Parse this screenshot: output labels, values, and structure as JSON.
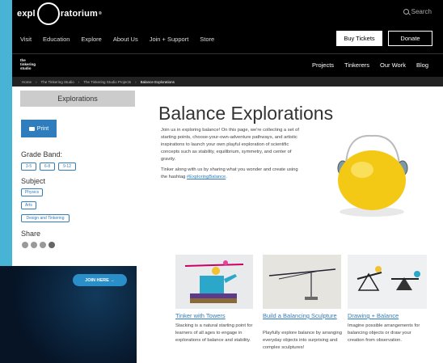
{
  "header": {
    "logo_pre": "expl",
    "logo_post": "ratorium",
    "search_label": "Search",
    "nav": [
      "Visit",
      "Education",
      "Explore",
      "About Us",
      "Join + Support",
      "Store"
    ],
    "buy_tickets": "Buy Tickets",
    "donate": "Donate"
  },
  "subheader": {
    "studio_logo": [
      "the",
      "tinkering",
      "studio"
    ],
    "nav": [
      "Projects",
      "Tinkerers",
      "Our Work",
      "Blog"
    ]
  },
  "breadcrumb": [
    "Home",
    "The Tinkering Studio",
    "The Tinkering Studio Projects",
    "Balance Explorations"
  ],
  "sidebar": {
    "tab_label": "Explorations",
    "print_label": "Print",
    "grade_band_label": "Grade Band:",
    "grade_bands": [
      "3-5",
      "6-8",
      "9-12"
    ],
    "subject_label": "Subject",
    "subjects": [
      "Physics",
      "Arts",
      "Design and Tinkering"
    ],
    "share_label": "Share"
  },
  "main": {
    "title": "Balance Explorations",
    "intro_p1": "Join us in exploring balance! On this page, we're collecting a set of starting points, choose-your-own-adventure pathways, and artistic inspirations to launch your own playful exploration of scientific concepts such as stability, equilibrium, symmetry, and center of gravity.",
    "intro_p2_pre": "Tinker along with us by sharing what you wonder and create using the hashtag ",
    "intro_hashtag": "#ExploringBalance",
    "intro_p2_post": "."
  },
  "cards": [
    {
      "title": "Tinker with Towers",
      "desc": "Stacking is a natural starting point for learners of all ages to engage in explorations of balance and stability."
    },
    {
      "title": "Build a Balancing Sculpture",
      "desc": "Playfully explore balance by arranging everyday objects into surprising and complex sculptures!"
    },
    {
      "title": "Drawing + Balance",
      "desc": "Imagine possible arrangements for balancing objects or draw your creation from observation."
    }
  ],
  "ad": {
    "button_label": "JOIN HERE →"
  },
  "colors": {
    "accent": "#2f7dbd",
    "frame": "#47b4d6",
    "header": "#000000"
  }
}
